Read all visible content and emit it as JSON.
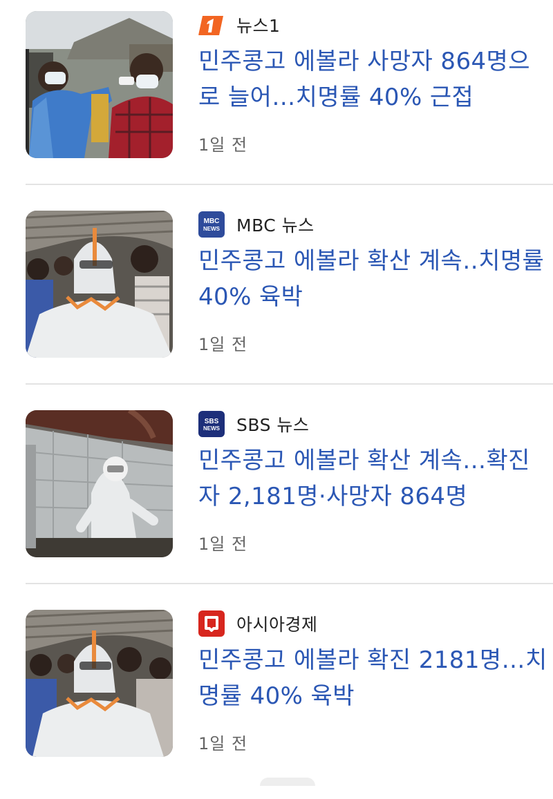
{
  "news": [
    {
      "source": {
        "name": "뉴스1",
        "logo_icon": "news1-logo-icon",
        "logo_text": "1",
        "logo_color": "#f26522"
      },
      "headline": "민주콩고 에볼라 사망자 864명으로 늘어…치명률 40% 근접",
      "time": "1일 전",
      "image": "health-worker-masks-photo"
    },
    {
      "source": {
        "name": "MBC 뉴스",
        "logo_icon": "mbc-news-logo-icon",
        "logo_text": "MBC NEWS",
        "logo_color": "#2e4b9b"
      },
      "headline": "민주콩고 에볼라 확산 계속‥치명률 40% 육박",
      "time": "1일 전",
      "image": "hazmat-suit-crowd-photo"
    },
    {
      "source": {
        "name": "SBS 뉴스",
        "logo_icon": "sbs-news-logo-icon",
        "logo_text": "SBS NEWS",
        "logo_color": "#1d2f7a"
      },
      "headline": "민주콩고 에볼라 확산 계속…확진자 2,181명·사망자 864명",
      "time": "1일 전",
      "image": "hazmat-suit-tent-photo"
    },
    {
      "source": {
        "name": "아시아경제",
        "logo_icon": "asiae-logo-icon",
        "logo_text": "",
        "logo_color": "#d7261e"
      },
      "headline": "민주콩고 에볼라 확진 2181명…치명률 40% 육박",
      "time": "1일 전",
      "image": "hazmat-suit-crowd-photo"
    }
  ],
  "colors": {
    "headline": "#2b57b4",
    "source_text": "#222222",
    "time_text": "#666666",
    "divider": "#e3e3e3"
  }
}
